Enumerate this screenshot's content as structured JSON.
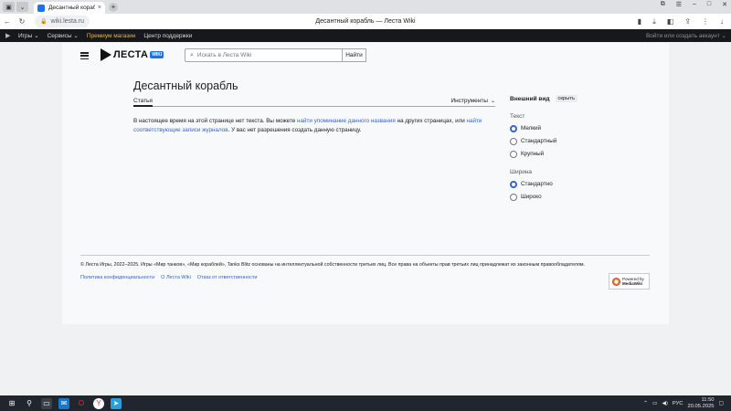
{
  "browser": {
    "tab_title": "Десантный корабль — Лес",
    "tab_close": "×",
    "new_tab": "+",
    "url": "wiki.lesta.ru",
    "page_title": "Десантный корабль — Леста Wiki"
  },
  "lesta_bar": {
    "items": [
      "Игры",
      "Сервисы",
      "Премиум магазин",
      "Центр поддержки"
    ],
    "login_text": "Войти или создать аккаунт"
  },
  "header": {
    "brand": "ЛЕСТА",
    "brand_badge": "WIKI",
    "search_placeholder": "Искать в Леста Wiki",
    "search_button": "Найти"
  },
  "article": {
    "title": "Десантный корабль",
    "tab_article": "Статья",
    "tools": "Инструменты",
    "text_1": "В настоящее время на этой странице нет текста. Вы можете ",
    "link_1": "найти упоминание данного названия",
    "text_2": " на других страницах, или ",
    "link_2": "найти соответствующие записи журналов",
    "text_3": ". У вас нет разрешения создать данную страницу."
  },
  "appearance": {
    "title": "Внешний вид",
    "hide": "скрыть",
    "text_label": "Текст",
    "text_options": [
      "Мелкий",
      "Стандартный",
      "Крупный"
    ],
    "text_selected": 0,
    "width_label": "Ширина",
    "width_options": [
      "Стандартно",
      "Широко"
    ],
    "width_selected": 0
  },
  "footer": {
    "copyright": "© Леста Игры, 2022–2025. Игры «Мир танков», «Мир кораблей», Tanks Blitz основаны на интеллектуальной собственности третьих лиц. Все права на объекты прав третьих лиц принадлежат их законным правообладателям.",
    "links": [
      "Политика конфиденциальности",
      "О Леста Wiki",
      "Отказ от ответственности"
    ],
    "powered_line1": "Powered by",
    "powered_line2": "MediaWiki"
  },
  "taskbar": {
    "lang": "РУС",
    "time": "11:50",
    "date": "20.05.2025"
  }
}
